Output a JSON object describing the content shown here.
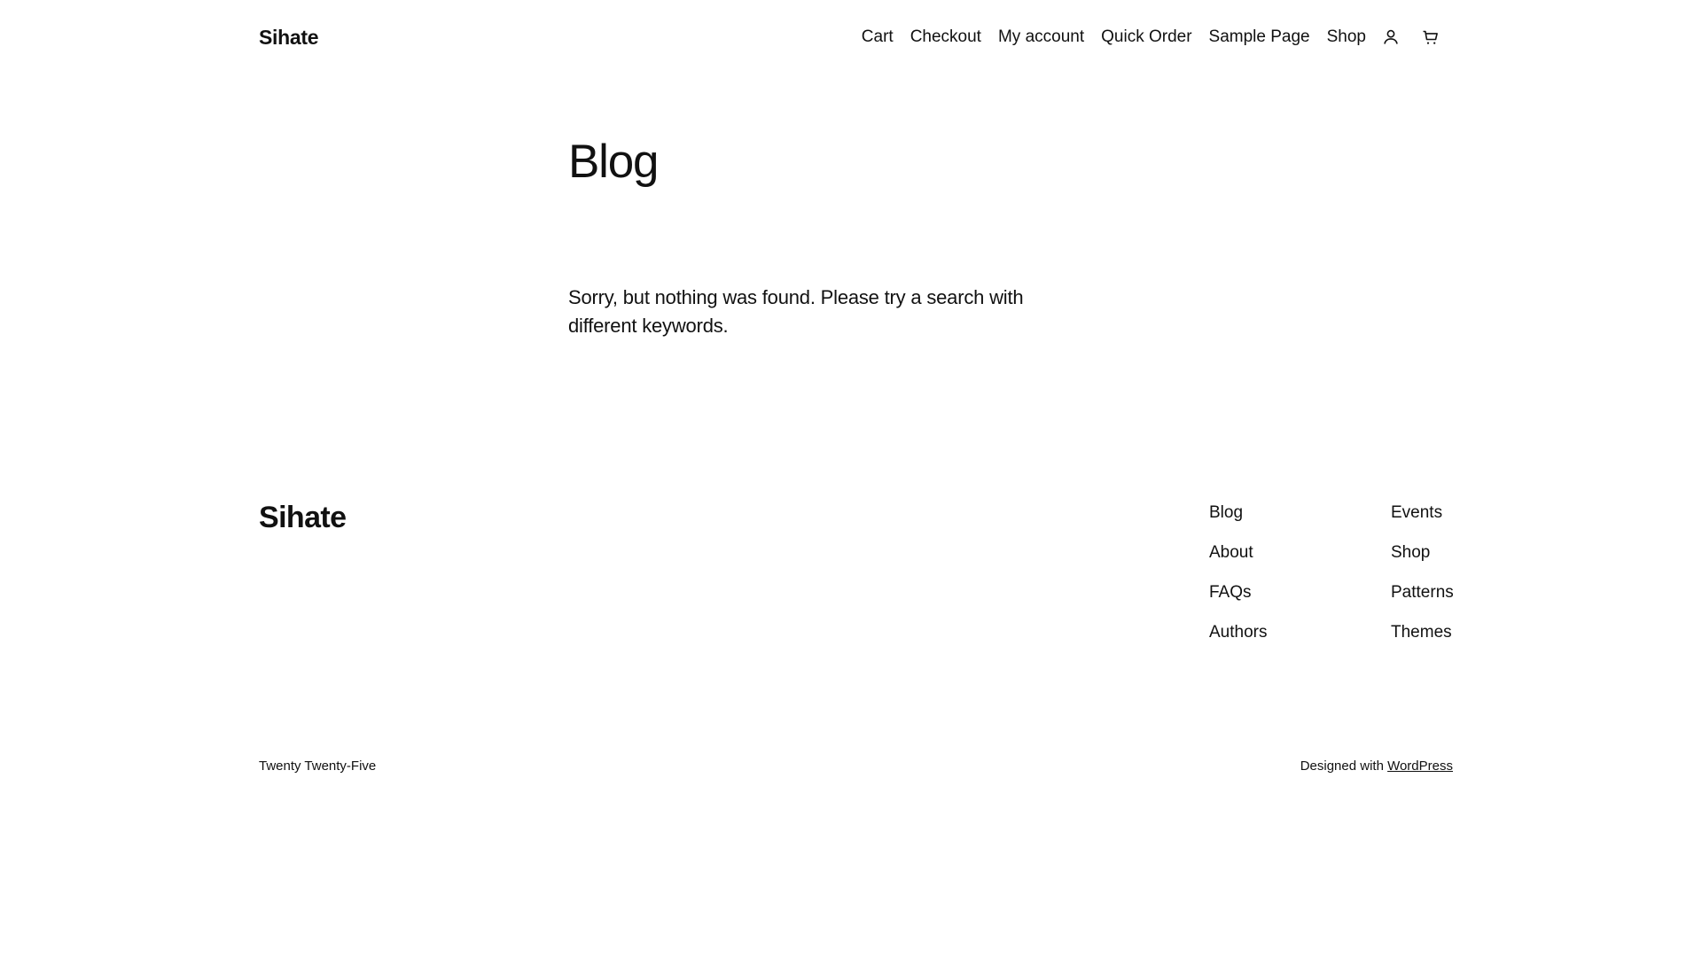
{
  "header": {
    "site_title": "Sihate",
    "nav": [
      "Cart",
      "Checkout",
      "My account",
      "Quick Order",
      "Sample Page",
      "Shop"
    ],
    "icons": [
      "user-icon",
      "cart-icon"
    ]
  },
  "main": {
    "title": "Blog",
    "message": "Sorry, but nothing was found. Please try a search with different keywords."
  },
  "footer": {
    "site_title": "Sihate",
    "column_1": [
      "Blog",
      "About",
      "FAQs",
      "Authors"
    ],
    "column_2": [
      "Events",
      "Shop",
      "Patterns",
      "Themes"
    ],
    "theme_name": "Twenty Twenty-Five",
    "credit_prefix": "Designed with",
    "credit_link": "WordPress"
  }
}
